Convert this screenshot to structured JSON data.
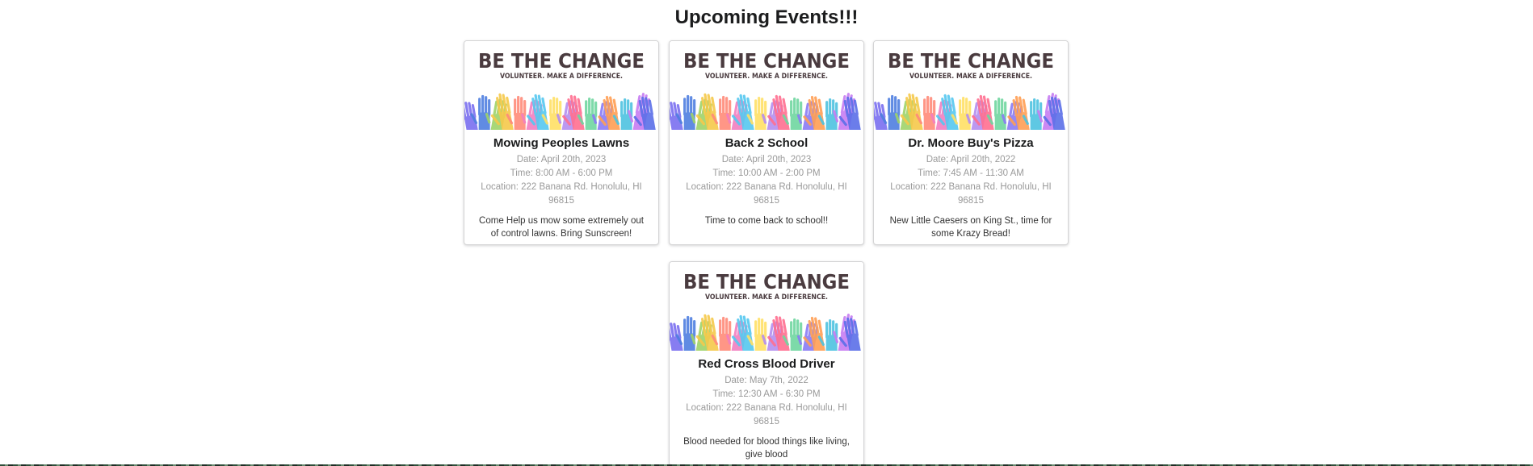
{
  "page": {
    "title": "Upcoming Events!!!"
  },
  "banner": {
    "headline": "BE THE CHANGE",
    "tagline": "VOLUNTEER. MAKE A DIFFERENCE.",
    "hand_colors": [
      "#7b6ff0",
      "#4f7fe0",
      "#9fd36a",
      "#f6c94b",
      "#ff8b7a",
      "#f27fc0",
      "#56c8f0",
      "#ffe066",
      "#b48ef0",
      "#ff6f91",
      "#70d6a0",
      "#8a7cf5",
      "#ff9f55",
      "#4ec3e0",
      "#c77df2",
      "#5b6fe8"
    ]
  },
  "events": [
    {
      "name": "Mowing Peoples Lawns",
      "date": "Date: April 20th, 2023",
      "time": "Time: 8:00 AM - 6:00 PM",
      "location": "Location: 222 Banana Rd. Honolulu, HI 96815",
      "description": "Come Help us mow some extremely out of control lawns. Bring Sunscreen!"
    },
    {
      "name": "Back 2 School",
      "date": "Date: April 20th, 2023",
      "time": "Time: 10:00 AM - 2:00 PM",
      "location": "Location: 222 Banana Rd. Honolulu, HI 96815",
      "description": "Time to come back to school!!"
    },
    {
      "name": "Dr. Moore Buy's Pizza",
      "date": "Date: April 20th, 2022",
      "time": "Time: 7:45 AM - 11:30 AM",
      "location": "Location: 222 Banana Rd. Honolulu, HI 96815",
      "description": "New Little Caesers on King St., time for some Krazy Bread!"
    },
    {
      "name": "Red Cross Blood Driver",
      "date": "Date: May 7th, 2022",
      "time": "Time: 12:30 AM - 6:30 PM",
      "location": "Location: 222 Banana Rd. Honolulu, HI 96815",
      "description": "Blood needed for blood things like living, give blood"
    }
  ]
}
